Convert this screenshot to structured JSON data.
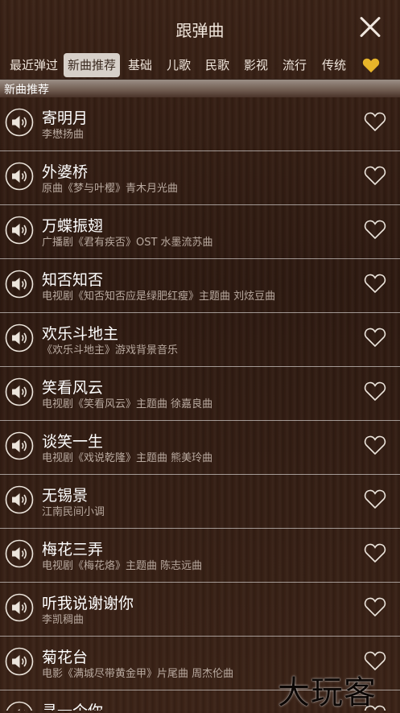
{
  "header": {
    "title": "跟弹曲"
  },
  "tabs": [
    {
      "label": "最近弹过"
    },
    {
      "label": "新曲推荐",
      "active": true
    },
    {
      "label": "基础"
    },
    {
      "label": "儿歌"
    },
    {
      "label": "民歌"
    },
    {
      "label": "影视"
    },
    {
      "label": "流行"
    },
    {
      "label": "传统"
    }
  ],
  "favorites_tab_icon": "heart-icon",
  "favorites_tab_color": "#e8b52a",
  "section": {
    "label": "新曲推荐"
  },
  "songs": [
    {
      "title": "寄明月",
      "subtitle": "李懋扬曲"
    },
    {
      "title": "外婆桥",
      "subtitle": "原曲《梦与叶樱》青木月光曲"
    },
    {
      "title": "万蝶振翅",
      "subtitle": "广播剧《君有疾否》OST 水墨流苏曲"
    },
    {
      "title": "知否知否",
      "subtitle": "电视剧《知否知否应是绿肥红瘦》主题曲 刘炫豆曲"
    },
    {
      "title": "欢乐斗地主",
      "subtitle": "《欢乐斗地主》游戏背景音乐"
    },
    {
      "title": "笑看风云",
      "subtitle": "电视剧《笑看风云》主题曲 徐嘉良曲"
    },
    {
      "title": "谈笑一生",
      "subtitle": "电视剧《戏说乾隆》主题曲 熊美玲曲"
    },
    {
      "title": "无锡景",
      "subtitle": "江南民间小调"
    },
    {
      "title": "梅花三弄",
      "subtitle": "电视剧《梅花烙》主题曲 陈志远曲"
    },
    {
      "title": "听我说谢谢你",
      "subtitle": "李凯稠曲"
    },
    {
      "title": "菊花台",
      "subtitle": "电影《满城尽带黄金甲》片尾曲 周杰伦曲"
    },
    {
      "title": "寻一个你",
      "subtitle": ""
    }
  ],
  "watermark": "大玩客"
}
